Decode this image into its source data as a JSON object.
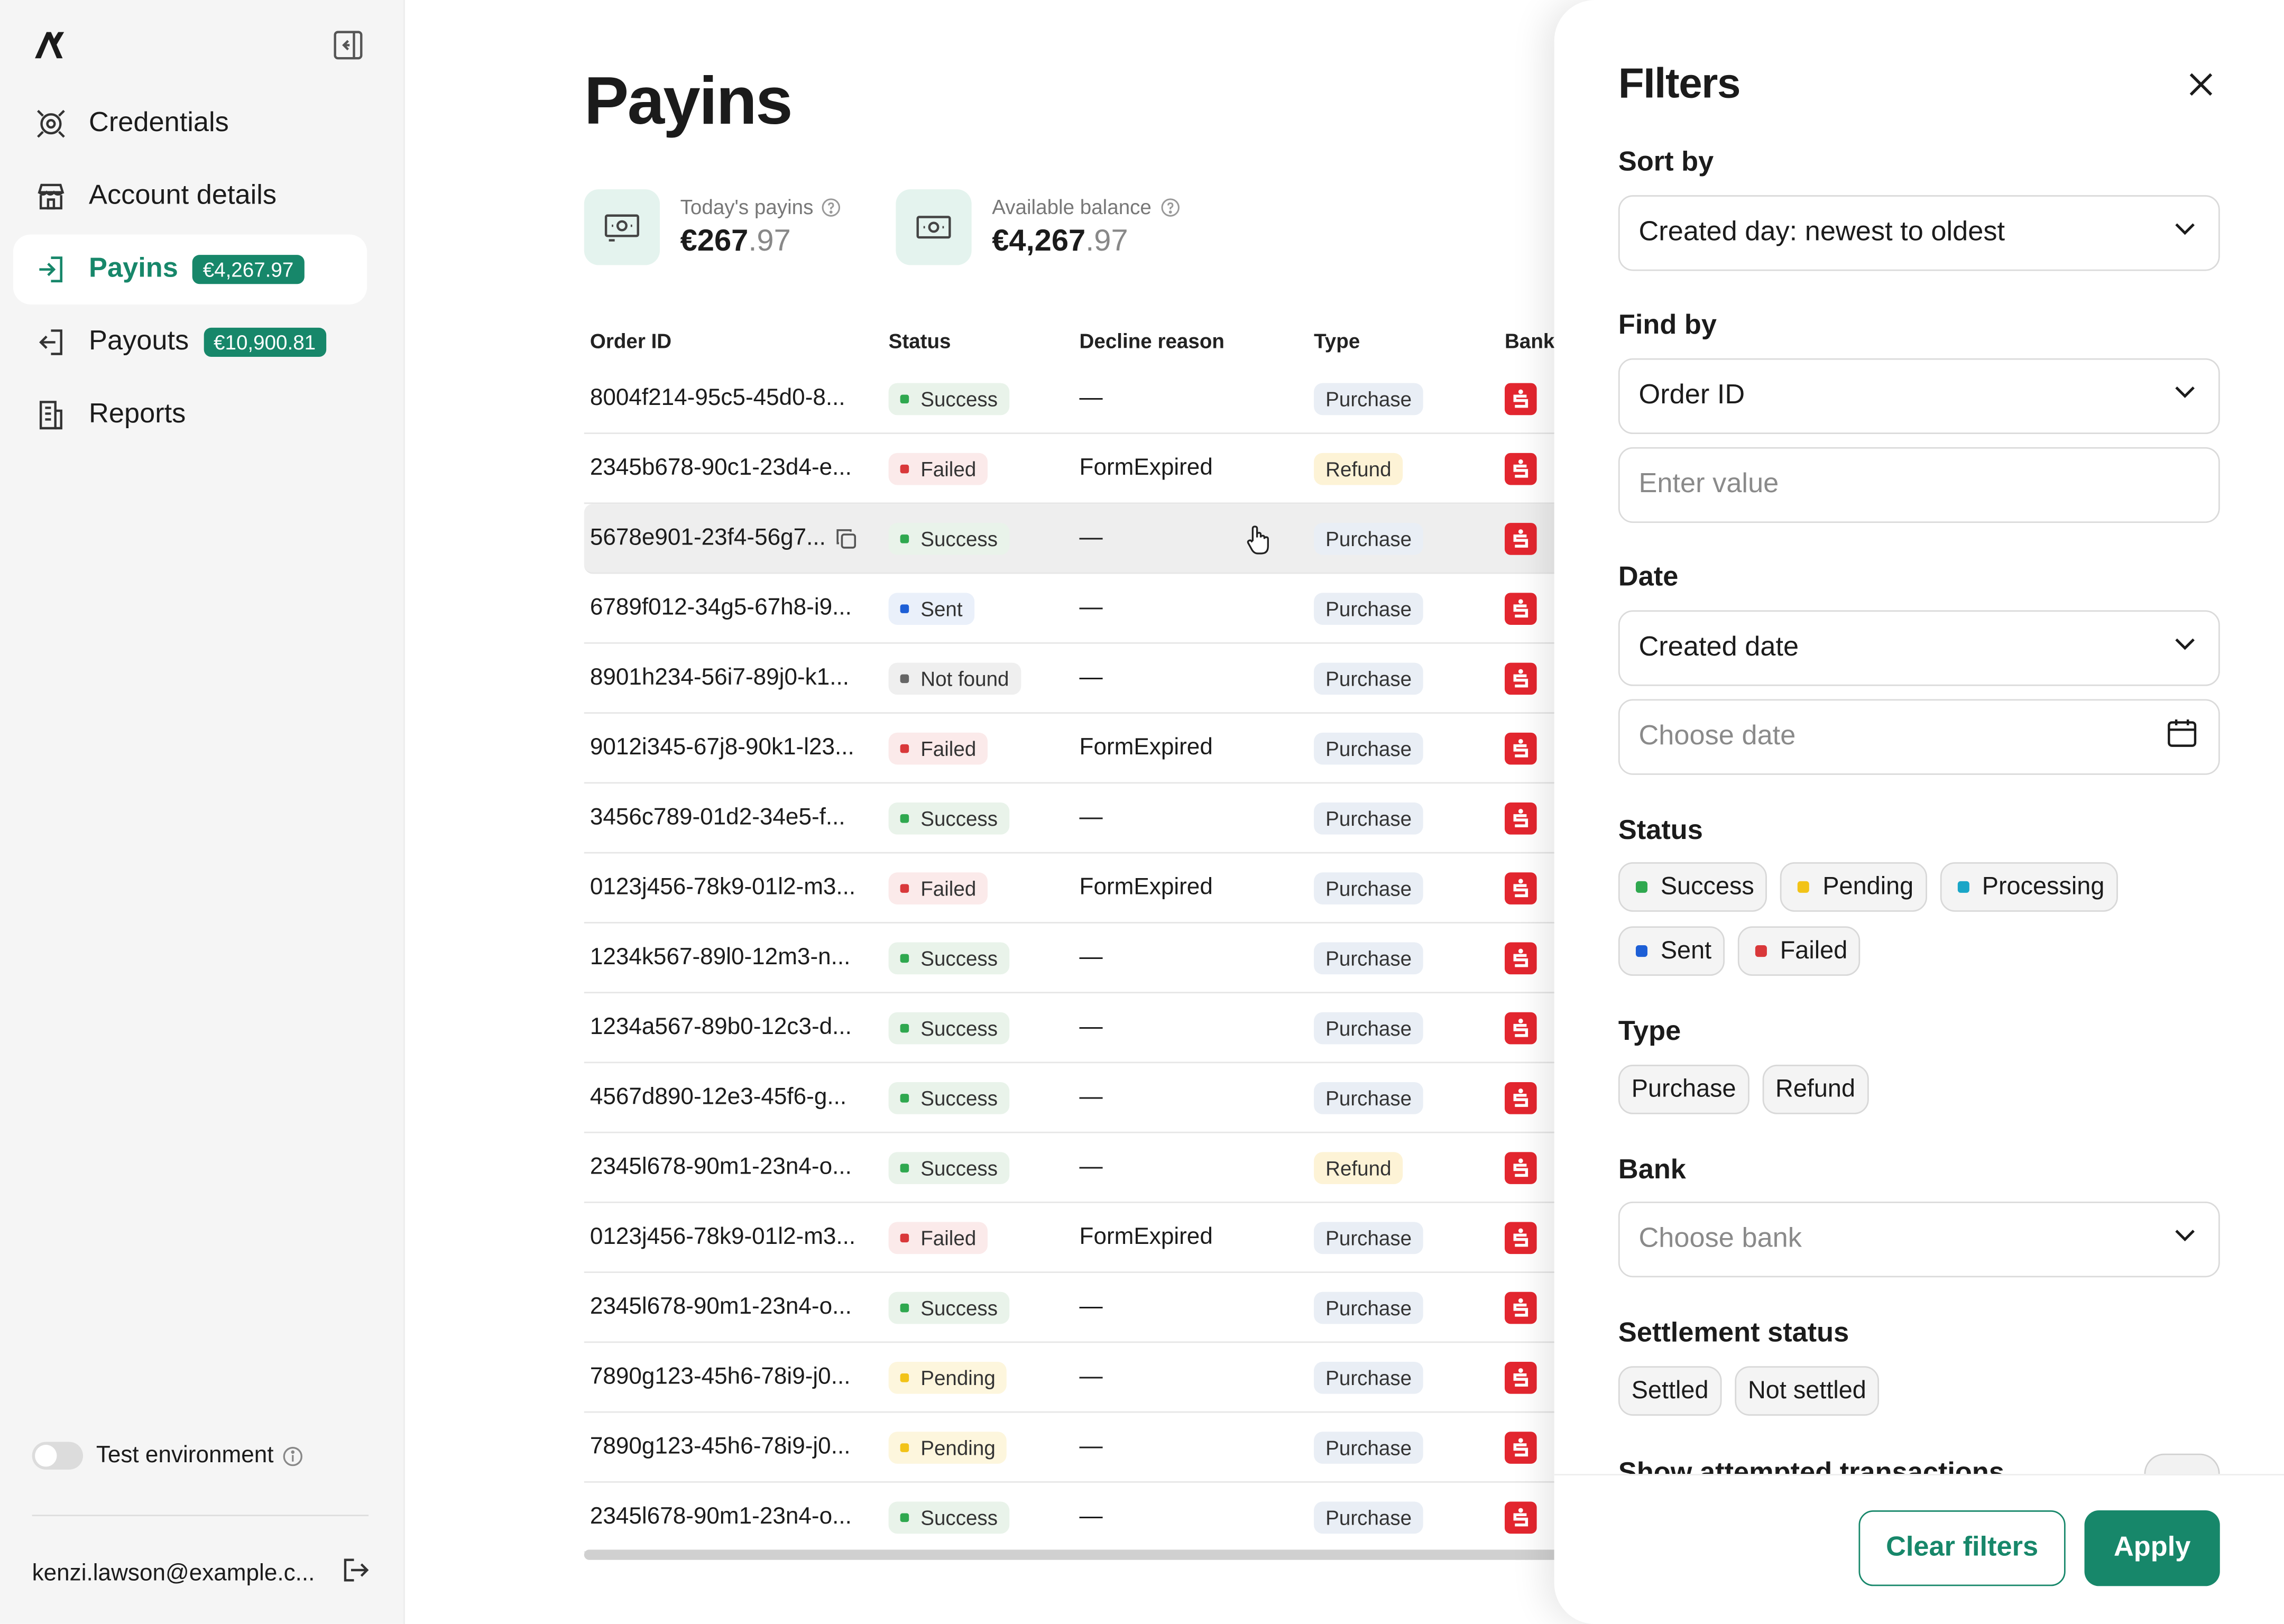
{
  "sidebar": {
    "nav": [
      {
        "label": "Credentials",
        "icon": "credentials-icon",
        "badge": ""
      },
      {
        "label": "Account details",
        "icon": "storefront-icon",
        "badge": ""
      },
      {
        "label": "Payins",
        "icon": "payin-icon",
        "badge": "€4,267.97",
        "active": true
      },
      {
        "label": "Payouts",
        "icon": "payout-icon",
        "badge": "€10,900.81"
      },
      {
        "label": "Reports",
        "icon": "reports-icon",
        "badge": ""
      }
    ],
    "test_env_label": "Test environment",
    "user_email": "kenzi.lawson@example.c..."
  },
  "main": {
    "title": "Payins",
    "stats": [
      {
        "label": "Today's payins",
        "value_main": "€267",
        "value_cents": ".97"
      },
      {
        "label": "Available balance",
        "value_main": "€4,267",
        "value_cents": ".97"
      }
    ],
    "table": {
      "headers": {
        "order_id": "Order ID",
        "status": "Status",
        "decline": "Decline reason",
        "type": "Type",
        "bank": "Bank"
      },
      "rows": [
        {
          "id": "8004f214-95c5-45d0-8...",
          "status": "Success",
          "decline": "—",
          "type": "Purchase"
        },
        {
          "id": "2345b678-90c1-23d4-e...",
          "status": "Failed",
          "decline": "FormExpired",
          "type": "Refund"
        },
        {
          "id": "5678e901-23f4-56g7...",
          "status": "Success",
          "decline": "—",
          "type": "Purchase"
        },
        {
          "id": "6789f012-34g5-67h8-i9...",
          "status": "Sent",
          "decline": "—",
          "type": "Purchase"
        },
        {
          "id": "8901h234-56i7-89j0-k1...",
          "status": "Not found",
          "decline": "—",
          "type": "Purchase"
        },
        {
          "id": "9012i345-67j8-90k1-l23...",
          "status": "Failed",
          "decline": "FormExpired",
          "type": "Purchase"
        },
        {
          "id": "3456c789-01d2-34e5-f...",
          "status": "Success",
          "decline": "—",
          "type": "Purchase"
        },
        {
          "id": "0123j456-78k9-01l2-m3...",
          "status": "Failed",
          "decline": "FormExpired",
          "type": "Purchase"
        },
        {
          "id": "1234k567-89l0-12m3-n...",
          "status": "Success",
          "decline": "—",
          "type": "Purchase"
        },
        {
          "id": "1234a567-89b0-12c3-d...",
          "status": "Success",
          "decline": "—",
          "type": "Purchase"
        },
        {
          "id": "4567d890-12e3-45f6-g...",
          "status": "Success",
          "decline": "—",
          "type": "Purchase"
        },
        {
          "id": "2345l678-90m1-23n4-o...",
          "status": "Success",
          "decline": "—",
          "type": "Refund"
        },
        {
          "id": "0123j456-78k9-01l2-m3...",
          "status": "Failed",
          "decline": "FormExpired",
          "type": "Purchase"
        },
        {
          "id": "2345l678-90m1-23n4-o...",
          "status": "Success",
          "decline": "—",
          "type": "Purchase"
        },
        {
          "id": "7890g123-45h6-78i9-j0...",
          "status": "Pending",
          "decline": "—",
          "type": "Purchase"
        },
        {
          "id": "7890g123-45h6-78i9-j0...",
          "status": "Pending",
          "decline": "—",
          "type": "Purchase"
        },
        {
          "id": "2345l678-90m1-23n4-o...",
          "status": "Success",
          "decline": "—",
          "type": "Purchase"
        }
      ]
    }
  },
  "filters": {
    "title": "FIlters",
    "sort_by": {
      "label": "Sort by",
      "value": "Created day: newest to oldest"
    },
    "find_by": {
      "label": "Find by",
      "value": "Order ID",
      "input_placeholder": "Enter value"
    },
    "date": {
      "label": "Date",
      "value": "Created date",
      "input_placeholder": "Choose date"
    },
    "status": {
      "label": "Status",
      "options": [
        {
          "label": "Success",
          "color": "#2fa84f"
        },
        {
          "label": "Pending",
          "color": "#f2c318"
        },
        {
          "label": "Processing",
          "color": "#1aa6c7"
        },
        {
          "label": "Sent",
          "color": "#1d5fd6"
        },
        {
          "label": "Failed",
          "color": "#d9383a"
        }
      ]
    },
    "type": {
      "label": "Type",
      "options": [
        "Purchase",
        "Refund"
      ]
    },
    "bank": {
      "label": "Bank",
      "placeholder": "Choose bank"
    },
    "settlement": {
      "label": "Settlement status",
      "options": [
        "Settled",
        "Not settled"
      ]
    },
    "attempted_label": "Show attempted transactions",
    "clear_label": "Clear filters",
    "apply_label": "Apply"
  },
  "colors": {
    "brand": "#17876a",
    "success": "#2fa84f",
    "failed": "#d9383a",
    "sent": "#1d5fd6",
    "pending": "#f2c318",
    "not_found": "#666666",
    "bank_red": "#e3262f"
  }
}
